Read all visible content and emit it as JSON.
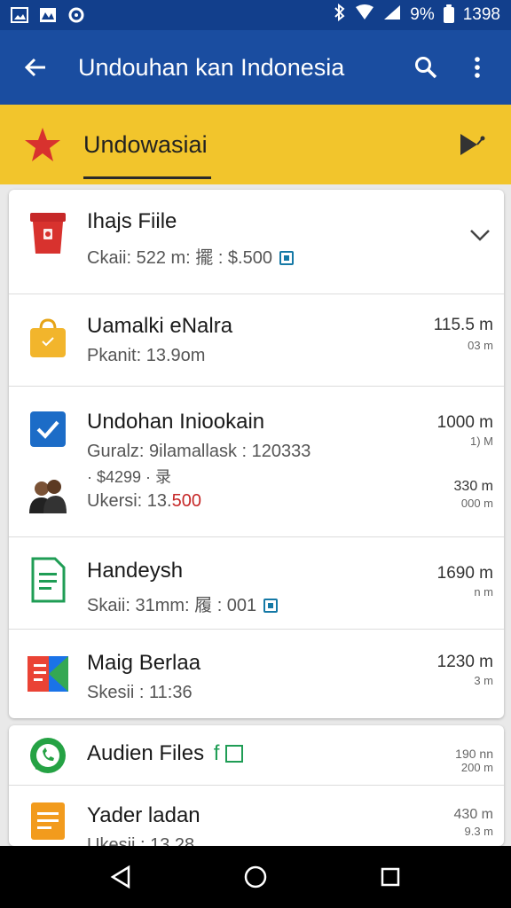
{
  "status_bar": {
    "icons_left": [
      "image-icon",
      "photos-icon",
      "sync-icon"
    ],
    "battery_text": "9%",
    "time": "1398"
  },
  "app_bar": {
    "title": "Undouhan kan Indonesia"
  },
  "tab_bar": {
    "label": "Undowasiai"
  },
  "files": [
    {
      "title": "Ihajs Fiile",
      "sub": "Ckaii: 522 m:  擺 : $.500",
      "icon": "red-box-icon"
    },
    {
      "title": "Uamalki eNalra",
      "sub": "Pkanit:   13.9om",
      "size": "115.5 m",
      "size_sub": "03 m",
      "icon": "yellow-bag-icon"
    },
    {
      "title": "Undohan Iniookain",
      "sub": "Guralz: 9ilamallask : 120333",
      "sub2": "· $4299 ·  录",
      "sub3_label": "Ukersi: 13.",
      "sub3_value": "500",
      "size": "1000 m",
      "size_sub": "1) M",
      "size2": "330 m",
      "size2_sub": "000 m",
      "icon": "blue-check-icon"
    },
    {
      "title": "Handeysh",
      "sub": "Skaii: 31mm:  履 : 001",
      "size": "1690 m",
      "size_sub": "n m",
      "icon": "green-doc-icon"
    },
    {
      "title": "Maig Berlaa",
      "sub": "Skesii : 11:36",
      "size": "1230 m",
      "size_sub": "3 m",
      "icon": "slides-icon"
    }
  ],
  "files2": [
    {
      "title": "Audien Files",
      "title_tag": "f",
      "size": "190 nn",
      "size_sub": "200 m",
      "icon": "whatsapp-icon"
    },
    {
      "title": "Yader ladan",
      "sub": "Ukesii : 13.28",
      "size": "430 m",
      "size_sub": "9.3 m",
      "icon": "orange-doc-icon"
    }
  ],
  "colors": {
    "status_bar": "#123f8c",
    "app_bar": "#1a4da0",
    "tab_bar": "#f2c52c",
    "accent_red": "#c62828"
  }
}
